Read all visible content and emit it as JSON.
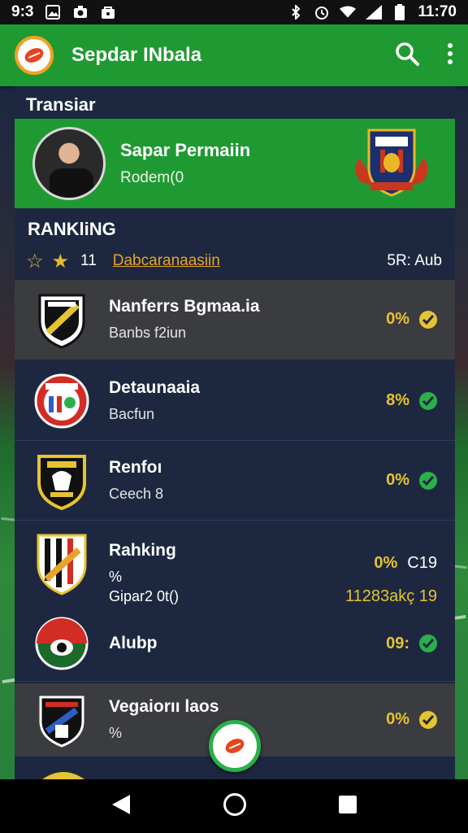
{
  "status_bar": {
    "time_left": "9:3",
    "time_right": "11:70",
    "icons_left": [
      "image-icon",
      "camera-icon",
      "bag-icon"
    ],
    "icons_right": [
      "bluetooth-icon",
      "alarm-icon",
      "wifi-icon",
      "signal-icon",
      "battery-icon"
    ]
  },
  "app_bar": {
    "title": "Sepdar INbala",
    "icons": [
      "search-icon",
      "more-vert-icon"
    ]
  },
  "section_title": "Transiar",
  "featured": {
    "name": "Sapar Permaiin",
    "sub": "Rodem(0"
  },
  "ranking": {
    "title": "RANKliNG",
    "count": "11",
    "link": "Dabcaranaasiin",
    "right": "5R: Aub"
  },
  "items": [
    {
      "title": "Nanferrs Bgmaa.ia",
      "sub": "Banbs f2iun",
      "pct": "0%",
      "check": "gold"
    },
    {
      "title": "Detaunaaia",
      "sub": "Bacfun",
      "pct": "8%",
      "check": "green"
    },
    {
      "title": "Renfoı",
      "sub": "Ceech 8",
      "pct": "0%",
      "check": "green"
    }
  ],
  "tall_item": {
    "title": "Rahking",
    "pct": "0%",
    "pct_right": "C19",
    "symbol": "%",
    "sub": "Gipar2 0t()",
    "value": "11283akç 19",
    "title2": "Alubp",
    "pct2": "09:"
  },
  "last_item": {
    "title": "Vegaiorıı laos",
    "sub": "%",
    "pct": "0%"
  },
  "colors": {
    "primary": "#1f9a32",
    "panel": "#1d2840",
    "accent_gold": "#e5c431",
    "accent_green": "#2ab04a"
  }
}
